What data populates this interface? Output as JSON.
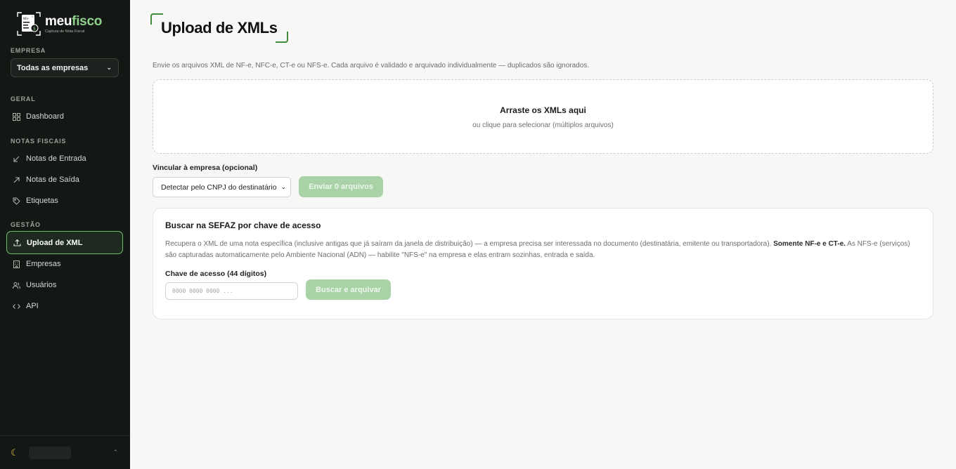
{
  "brand": {
    "name_part1": "meu",
    "name_part2": "fisco",
    "tagline": "Captura de Nota Fiscal"
  },
  "sidebar": {
    "company_label": "EMPRESA",
    "company_selected": "Todas as empresas",
    "sections": {
      "geral": "GERAL",
      "notas": "NOTAS FISCAIS",
      "gestao": "GESTÃO"
    },
    "items": {
      "dashboard": "Dashboard",
      "notas_entrada": "Notas de Entrada",
      "notas_saida": "Notas de Saída",
      "etiquetas": "Etiquetas",
      "upload_xml": "Upload de XML",
      "empresas": "Empresas",
      "usuarios": "Usuários",
      "api": "API"
    },
    "active_item": "upload_xml"
  },
  "page": {
    "title": "Upload de XMLs",
    "intro": "Envie os arquivos XML de NF-e, NFC-e, CT-e ou NFS-e. Cada arquivo é validado e arquivado individualmente — duplicados são ignorados."
  },
  "dropzone": {
    "title": "Arraste os XMLs aqui",
    "subtitle": "ou clique para selecionar (múltiplos arquivos)"
  },
  "link_company": {
    "label": "Vincular à empresa (opcional)",
    "selected": "Detectar pelo CNPJ do destinatário",
    "send_button": "Enviar 0 arquivos"
  },
  "sefaz": {
    "title": "Buscar na SEFAZ por chave de acesso",
    "desc_part1": "Recupera o XML de uma nota específica (inclusive antigas que já saíram da janela de distribuição) — a empresa precisa ser interessada no documento (destinatária, emitente ou transportadora).",
    "desc_bold": "Somente NF-e e CT-e.",
    "desc_part2": "As NFS-e (serviços) são capturadas automaticamente pelo Ambiente Nacional (ADN) — habilite \"NFS-e\" na empresa e elas entram sozinhas, entrada e saída.",
    "key_label": "Chave de acesso (44 dígitos)",
    "key_placeholder": "0000 0000 0000 ...",
    "search_button": "Buscar e arquivar"
  },
  "colors": {
    "sidebar_bg": "#141815",
    "accent_green": "#6dc067",
    "button_disabled": "#a9d2a7",
    "page_bg": "#f7f7f6"
  }
}
